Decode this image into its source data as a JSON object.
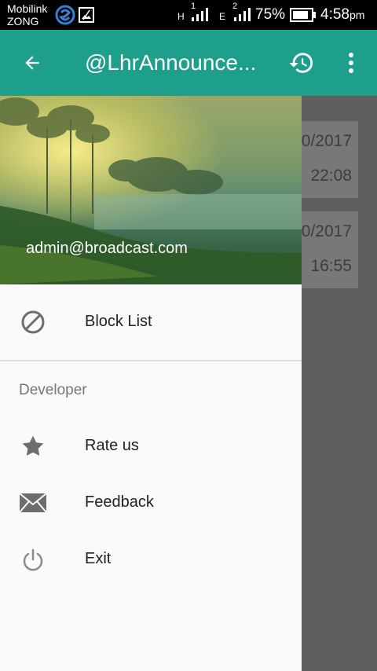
{
  "status_bar": {
    "carrier_line1": "Mobilink",
    "carrier_line2": "ZONG",
    "sim1_network": "H",
    "sim1_index": "1",
    "sim2_network": "E",
    "sim2_index": "2",
    "battery": "75%",
    "time": "4:58",
    "time_suffix": "pm"
  },
  "toolbar": {
    "title": "@LhrAnnounce...",
    "back_icon": "arrow-back-icon",
    "history_icon": "history-icon",
    "more_icon": "more-vert-icon",
    "color": "#1d9f8c"
  },
  "background_list": {
    "items": [
      {
        "date": "0/2017",
        "time": "22:08"
      },
      {
        "date": "0/2017",
        "time": "16:55"
      }
    ]
  },
  "drawer": {
    "email": "admin@broadcast.com",
    "items": [
      {
        "label": "Block List",
        "icon": "block-icon"
      }
    ],
    "section_label": "Developer",
    "developer_items": [
      {
        "label": "Rate us",
        "icon": "star-icon"
      },
      {
        "label": "Feedback",
        "icon": "mail-icon"
      },
      {
        "label": "Exit",
        "icon": "power-icon"
      }
    ]
  }
}
